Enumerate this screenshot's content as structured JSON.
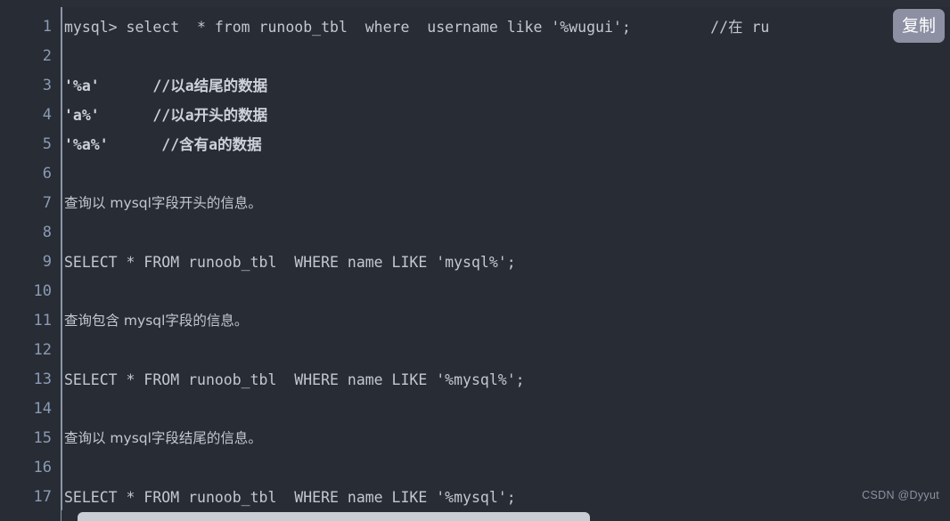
{
  "code_block": {
    "background_color": "#282c34",
    "text_color": "#c3c8d0",
    "gutter_color": "#8a9bb5",
    "lines": [
      {
        "number": "1",
        "text": "mysql> select  * from runoob_tbl  where  username like '%wugui';         //在 ru",
        "style": "mono"
      },
      {
        "number": "2",
        "text": "",
        "style": "mono"
      },
      {
        "number": "3",
        "text": "'%a'      //以a结尾的数据",
        "style": "bold"
      },
      {
        "number": "4",
        "text": "'a%'      //以a开头的数据",
        "style": "bold"
      },
      {
        "number": "5",
        "text": "'%a%'      //含有a的数据",
        "style": "bold"
      },
      {
        "number": "6",
        "text": "",
        "style": "mono"
      },
      {
        "number": "7",
        "text": "查询以 mysql字段开头的信息。",
        "style": "cn"
      },
      {
        "number": "8",
        "text": "",
        "style": "mono"
      },
      {
        "number": "9",
        "text": "SELECT * FROM runoob_tbl  WHERE name LIKE 'mysql%';",
        "style": "mono"
      },
      {
        "number": "10",
        "text": "",
        "style": "mono"
      },
      {
        "number": "11",
        "text": "查询包含 mysql字段的信息。",
        "style": "cn"
      },
      {
        "number": "12",
        "text": "",
        "style": "mono"
      },
      {
        "number": "13",
        "text": "SELECT * FROM runoob_tbl  WHERE name LIKE '%mysql%';",
        "style": "mono"
      },
      {
        "number": "14",
        "text": "",
        "style": "mono"
      },
      {
        "number": "15",
        "text": "查询以 mysql字段结尾的信息。",
        "style": "cn"
      },
      {
        "number": "16",
        "text": "",
        "style": "mono"
      },
      {
        "number": "17",
        "text": "SELECT * FROM runoob_tbl  WHERE name LIKE '%mysql';",
        "style": "mono"
      }
    ]
  },
  "copy_button": {
    "label": "复制",
    "background_color": "#8d8fa3",
    "text_color": "#ffffff"
  },
  "watermark": {
    "text": "CSDN @Dyyut"
  },
  "scrollbar": {
    "orientation": "horizontal",
    "thumb_color": "#c9cdd4"
  }
}
